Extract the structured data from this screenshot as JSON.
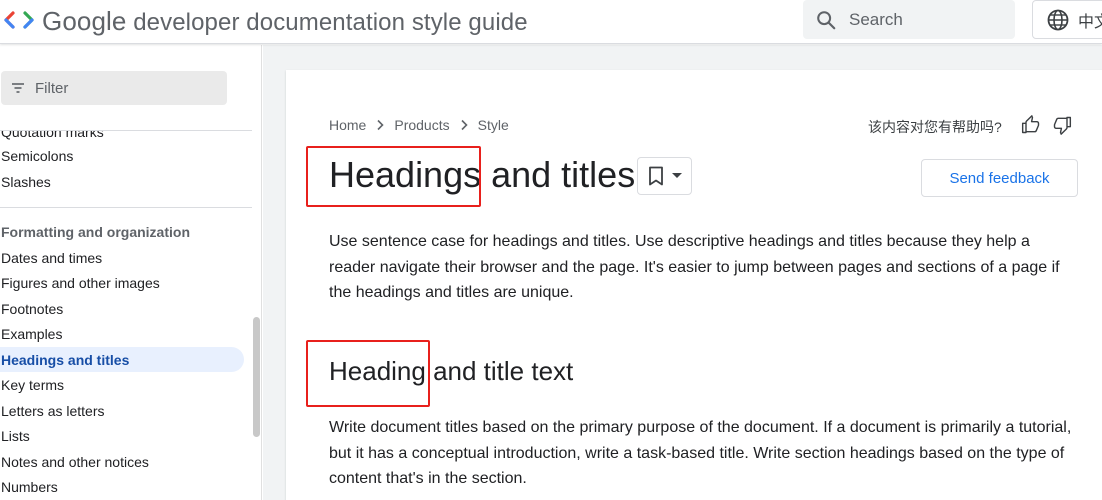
{
  "header": {
    "brand": "Google",
    "title_rest": "developer documentation style guide",
    "search_placeholder": "Search",
    "language": "中文"
  },
  "sidebar": {
    "filter_placeholder": "Filter",
    "partial_item": "Quotation marks",
    "items_top": [
      "Semicolons",
      "Slashes"
    ],
    "section_heading": "Formatting and organization",
    "items": [
      "Dates and times",
      "Figures and other images",
      "Footnotes",
      "Examples",
      "Headings and titles",
      "Key terms",
      "Letters as letters",
      "Lists",
      "Notes and other notices",
      "Numbers"
    ],
    "active_index": 4
  },
  "breadcrumb": [
    "Home",
    "Products",
    "Style"
  ],
  "helpful_prompt": "该内容对您有帮助吗?",
  "page": {
    "title_highlight": "Headings",
    "title_rest": " and titles",
    "send_feedback": "Send feedback",
    "intro": "Use sentence case for headings and titles. Use descriptive headings and titles because they help a reader navigate their browser and the page. It's easier to jump between pages and sections of a page if the headings and titles are unique.",
    "section_heading_highlight": "Heading",
    "section_heading_rest": " and title text",
    "section_body": "Write document titles based on the primary purpose of the document. If a document is primarily a tutorial, but it has a conceptual introduction, write a task-based title. Write section headings based on the type of content that's in the section."
  },
  "colors": {
    "accent": "#1a73e8",
    "highlight_box": "#e8201c",
    "active_nav_bg": "#e8f0fe"
  },
  "icons": [
    "developers-logo-icon",
    "search-icon",
    "globe-icon",
    "filter-icon",
    "chevron-right-icon",
    "thumb-up-icon",
    "thumb-down-icon",
    "bookmark-icon",
    "caret-down-icon"
  ]
}
